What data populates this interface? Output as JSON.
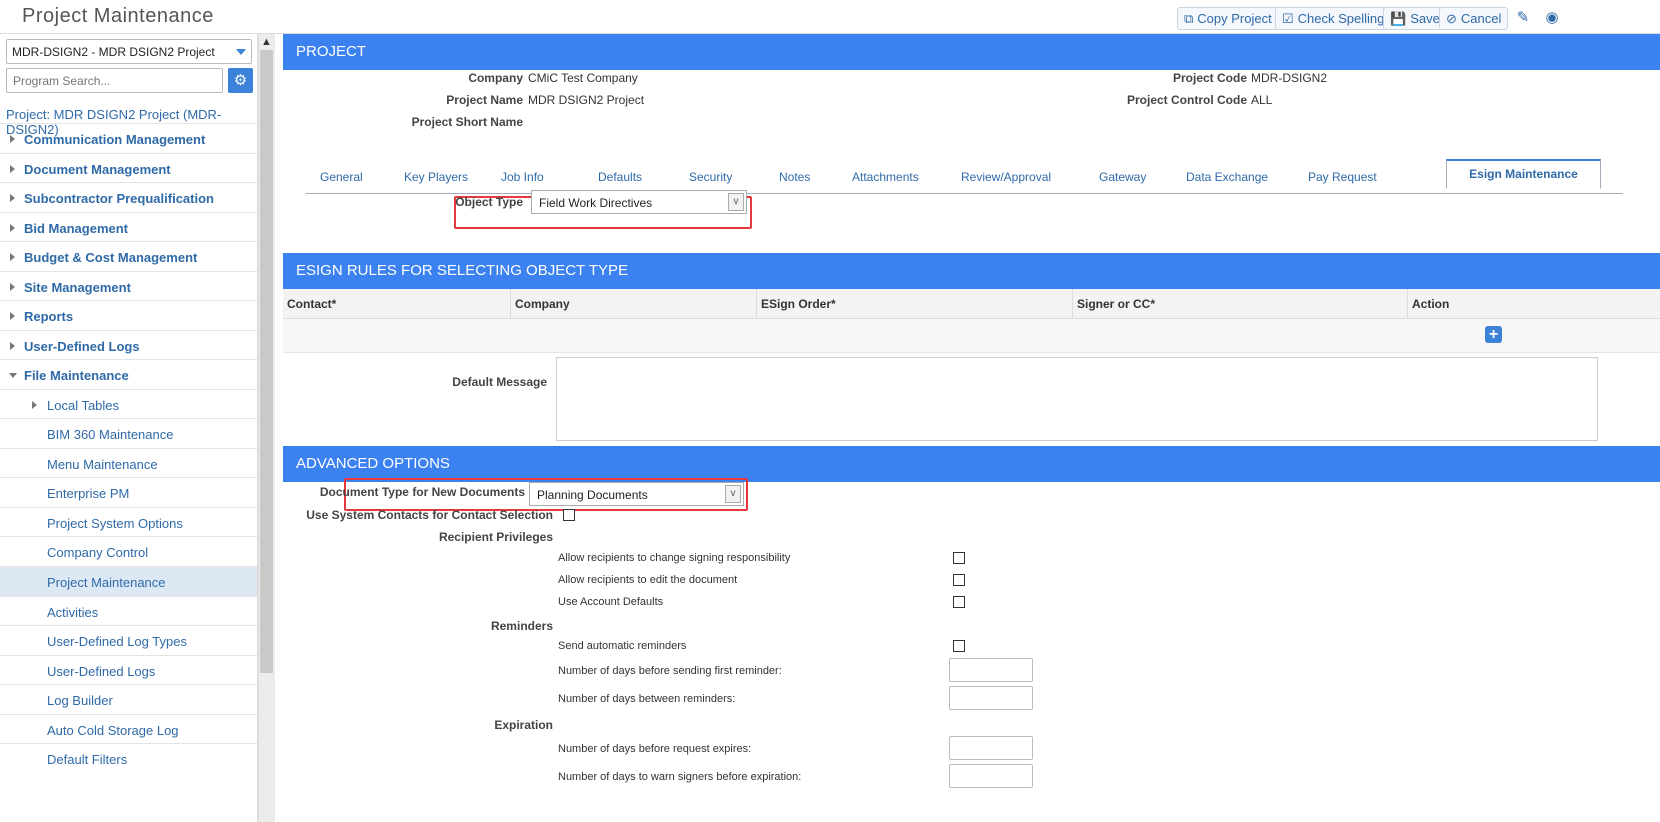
{
  "header": {
    "title": "Project Maintenance",
    "copy_label": "Copy Project",
    "spell_label": "Check Spelling",
    "save_label": "Save",
    "cancel_label": "Cancel"
  },
  "sidebar": {
    "project_select": "MDR-DSIGN2 - MDR DSIGN2 Project",
    "search_placeholder": "Program Search...",
    "project_link": "Project: MDR DSIGN2 Project (MDR-DSIGN2)",
    "items": [
      {
        "label": "Communication Management"
      },
      {
        "label": "Document Management"
      },
      {
        "label": "Subcontractor Prequalification"
      },
      {
        "label": "Bid Management"
      },
      {
        "label": "Budget & Cost Management"
      },
      {
        "label": "Site Management"
      },
      {
        "label": "Reports"
      },
      {
        "label": "User-Defined Logs"
      },
      {
        "label": "File Maintenance"
      }
    ],
    "sub_items": [
      {
        "label": "Local Tables"
      },
      {
        "label": "BIM 360 Maintenance"
      },
      {
        "label": "Menu Maintenance"
      },
      {
        "label": "Enterprise PM"
      },
      {
        "label": "Project System Options"
      },
      {
        "label": "Company Control"
      },
      {
        "label": "Project Maintenance"
      },
      {
        "label": "Activities"
      },
      {
        "label": "User-Defined Log Types"
      },
      {
        "label": "User-Defined Logs"
      },
      {
        "label": "Log Builder"
      },
      {
        "label": "Auto Cold Storage Log"
      },
      {
        "label": "Default Filters"
      }
    ]
  },
  "project": {
    "header": "PROJECT",
    "company_label": "Company",
    "company_value": "CMiC Test Company",
    "name_label": "Project Name",
    "name_value": "MDR DSIGN2 Project",
    "short_label": "Project Short Name",
    "code_label": "Project Code",
    "code_value": "MDR-DSIGN2",
    "control_label": "Project Control Code",
    "control_value": "ALL"
  },
  "tabs": [
    "General",
    "Key Players",
    "Job Info",
    "Defaults",
    "Security",
    "Notes",
    "Attachments",
    "Review/Approval",
    "Gateway",
    "Data Exchange",
    "Pay Request"
  ],
  "active_tab": "Esign Maintenance",
  "object_type": {
    "label": "Object Type",
    "value": "Field Work Directives"
  },
  "rules": {
    "header": "ESIGN RULES FOR SELECTING OBJECT TYPE",
    "columns": [
      "Contact*",
      "Company",
      "ESign Order*",
      "Signer or CC*",
      "Action"
    ]
  },
  "default_message_label": "Default Message",
  "advanced": {
    "header": "ADVANCED OPTIONS",
    "doc_type_label": "Document Type for New Documents",
    "doc_type_value": "Planning Documents",
    "use_sys_contacts": "Use System Contacts for Contact Selection",
    "recipient_priv": "Recipient Privileges",
    "allow_change": "Allow recipients to change signing responsibility",
    "allow_edit": "Allow recipients to edit the document",
    "use_defaults": "Use Account Defaults",
    "reminders": "Reminders",
    "send_auto": "Send automatic reminders",
    "days_first": "Number of days before sending first reminder:",
    "days_between": "Number of days between reminders:",
    "expiration": "Expiration",
    "days_expire": "Number of days before request expires:",
    "days_warn": "Number of days to warn signers before expiration:"
  },
  "colors": {
    "accent": "#3b82f0",
    "link": "#2f6aa8",
    "highlight": "#e5393d"
  }
}
